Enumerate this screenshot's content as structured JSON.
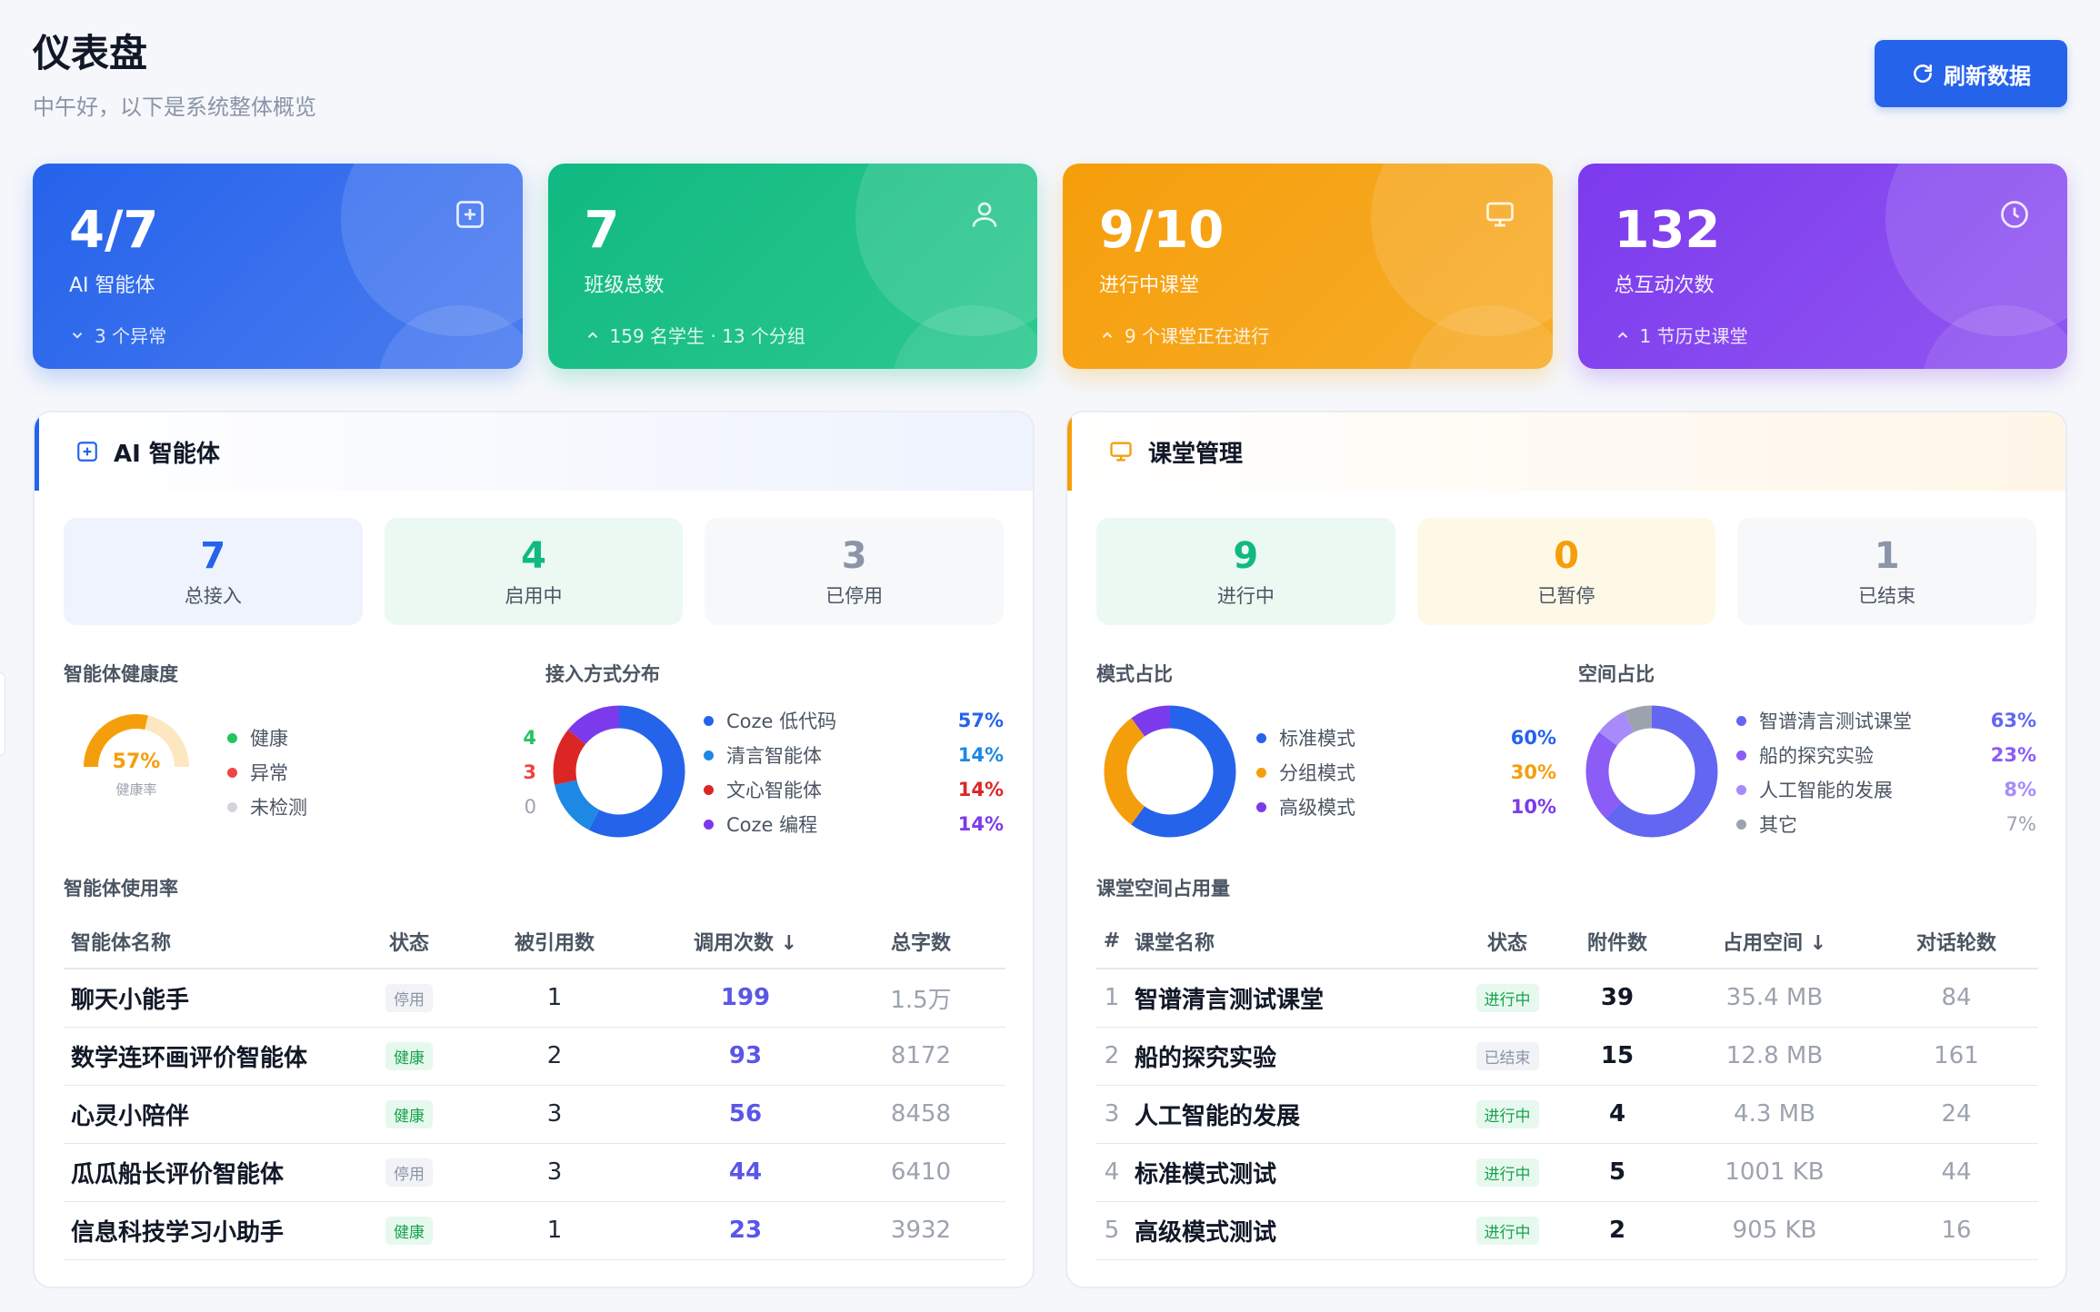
{
  "page": {
    "title": "仪表盘",
    "subtitle": "中午好，以下是系统整体概览",
    "refresh_label": "刷新数据"
  },
  "stats": [
    {
      "value": "4/7",
      "label": "AI 智能体",
      "trend": "3 个异常",
      "trend_dir": "down",
      "icon": "plus-square-icon",
      "color": "#2563eb"
    },
    {
      "value": "7",
      "label": "班级总数",
      "trend": "159 名学生 · 13 个分组",
      "trend_dir": "up",
      "icon": "user-icon",
      "color": "#10b981"
    },
    {
      "value": "9/10",
      "label": "进行中课堂",
      "trend": "9 个课堂正在进行",
      "trend_dir": "up",
      "icon": "monitor-icon",
      "color": "#f59e0b"
    },
    {
      "value": "132",
      "label": "总互动次数",
      "trend": "1 节历史课堂",
      "trend_dir": "up",
      "icon": "clock-icon",
      "color": "#7c3aed"
    }
  ],
  "agents": {
    "title": "AI 智能体",
    "mini": [
      {
        "value": "7",
        "label": "总接入",
        "color": "#2563eb",
        "bg": "#eef3fe"
      },
      {
        "value": "4",
        "label": "启用中",
        "color": "#10b981",
        "bg": "#ebf9f2"
      },
      {
        "value": "3",
        "label": "已停用",
        "color": "#8b95a7",
        "bg": "#f6f8fa"
      }
    ],
    "health": {
      "title": "智能体健康度",
      "value_text": "57%",
      "value": 57,
      "sub": "健康率",
      "items": [
        {
          "name": "健康",
          "count": "4",
          "color": "#22c55e"
        },
        {
          "name": "异常",
          "count": "3",
          "color": "#ef4444"
        },
        {
          "name": "未检测",
          "count": "0",
          "color": "#d1d5db"
        }
      ]
    },
    "access": {
      "title": "接入方式分布",
      "items": [
        {
          "name": "Coze 低代码",
          "pct": "57%",
          "value": 57,
          "color": "#2563eb"
        },
        {
          "name": "清言智能体",
          "pct": "14%",
          "value": 14,
          "color": "#1e88e5"
        },
        {
          "name": "文心智能体",
          "pct": "14%",
          "value": 14,
          "color": "#dc2626"
        },
        {
          "name": "Coze 编程",
          "pct": "14%",
          "value": 14,
          "color": "#7c3aed"
        }
      ]
    },
    "usage": {
      "title": "智能体使用率",
      "headers": [
        "智能体名称",
        "状态",
        "被引用数",
        "调用次数 ↓",
        "总字数"
      ],
      "rows": [
        {
          "name": "聊天小能手",
          "status": "停用",
          "status_type": "stop",
          "refs": "1",
          "calls": "199",
          "words": "1.5万"
        },
        {
          "name": "数学连环画评价智能体",
          "status": "健康",
          "status_type": "ok",
          "refs": "2",
          "calls": "93",
          "words": "8172"
        },
        {
          "name": "心灵小陪伴",
          "status": "健康",
          "status_type": "ok",
          "refs": "3",
          "calls": "56",
          "words": "8458"
        },
        {
          "name": "瓜瓜船长评价智能体",
          "status": "停用",
          "status_type": "stop",
          "refs": "3",
          "calls": "44",
          "words": "6410"
        },
        {
          "name": "信息科技学习小助手",
          "status": "健康",
          "status_type": "ok",
          "refs": "1",
          "calls": "23",
          "words": "3932"
        }
      ]
    }
  },
  "classes": {
    "title": "课堂管理",
    "mini": [
      {
        "value": "9",
        "label": "进行中",
        "color": "#10b981",
        "bg": "#ebf9f2"
      },
      {
        "value": "0",
        "label": "已暂停",
        "color": "#f59e0b",
        "bg": "#fef9e7"
      },
      {
        "value": "1",
        "label": "已结束",
        "color": "#8b95a7",
        "bg": "#f6f8fa"
      }
    ],
    "mode": {
      "title": "模式占比",
      "items": [
        {
          "name": "标准模式",
          "pct": "60%",
          "value": 60,
          "color": "#2563eb"
        },
        {
          "name": "分组模式",
          "pct": "30%",
          "value": 30,
          "color": "#f59e0b"
        },
        {
          "name": "高级模式",
          "pct": "10%",
          "value": 10,
          "color": "#7c3aed"
        }
      ]
    },
    "space": {
      "title": "空间占比",
      "items": [
        {
          "name": "智谱清言测试课堂",
          "pct": "63%",
          "value": 63,
          "color": "#6366f1"
        },
        {
          "name": "船的探究实验",
          "pct": "23%",
          "value": 23,
          "color": "#8b5cf6"
        },
        {
          "name": "人工智能的发展",
          "pct": "8%",
          "value": 8,
          "color": "#a78bfa"
        },
        {
          "name": "其它",
          "pct": "7%",
          "value": 7,
          "color": "#9ca3af"
        }
      ]
    },
    "storage": {
      "title": "课堂空间占用量",
      "headers": [
        "#",
        "课堂名称",
        "状态",
        "附件数",
        "占用空间 ↓",
        "对话轮数"
      ],
      "rows": [
        {
          "idx": "1",
          "name": "智谱清言测试课堂",
          "status": "进行中",
          "status_type": "run",
          "files": "39",
          "space": "35.4 MB",
          "turns": "84"
        },
        {
          "idx": "2",
          "name": "船的探究实验",
          "status": "已结束",
          "status_type": "end",
          "files": "15",
          "space": "12.8 MB",
          "turns": "161"
        },
        {
          "idx": "3",
          "name": "人工智能的发展",
          "status": "进行中",
          "status_type": "run",
          "files": "4",
          "space": "4.3 MB",
          "turns": "24"
        },
        {
          "idx": "4",
          "name": "标准模式测试",
          "status": "进行中",
          "status_type": "run",
          "files": "5",
          "space": "1001 KB",
          "turns": "44"
        },
        {
          "idx": "5",
          "name": "高级模式测试",
          "status": "进行中",
          "status_type": "run",
          "files": "2",
          "space": "905 KB",
          "turns": "16"
        }
      ]
    }
  }
}
